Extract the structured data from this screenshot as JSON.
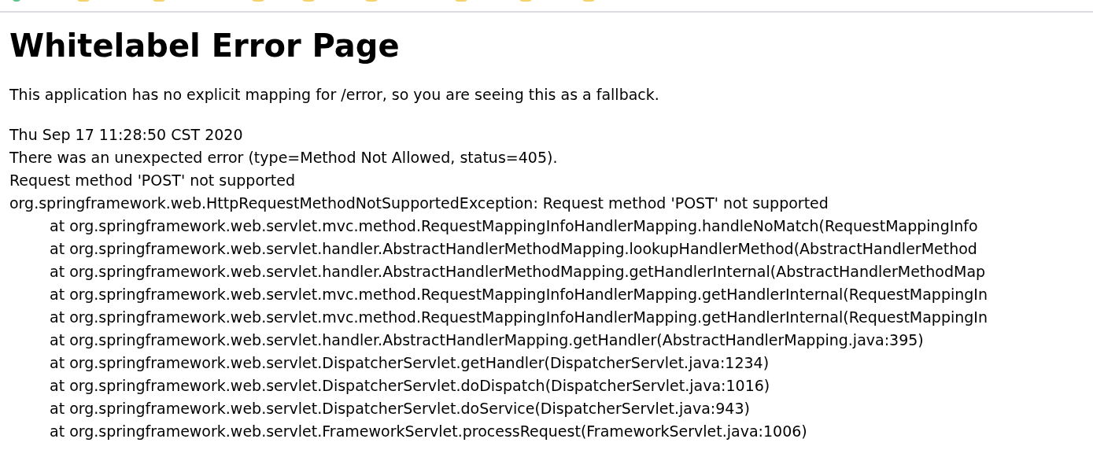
{
  "bookmarks_bar": {
    "items": [
      {
        "kind": "site"
      },
      {
        "kind": "folder"
      },
      {
        "kind": "folder"
      },
      {
        "kind": "folder"
      },
      {
        "kind": "folder"
      },
      {
        "kind": "folder"
      },
      {
        "kind": "folder"
      },
      {
        "kind": "folder"
      },
      {
        "kind": "folder"
      }
    ]
  },
  "heading": "Whitelabel Error Page",
  "message": "This application has no explicit mapping for /error, so you are seeing this as a fallback.",
  "details": [
    "Thu Sep 17 11:28:50 CST 2020",
    "There was an unexpected error (type=Method Not Allowed, status=405).",
    "Request method 'POST' not supported",
    "org.springframework.web.HttpRequestMethodNotSupportedException: Request method 'POST' not supported"
  ],
  "stack_trace": [
    "at org.springframework.web.servlet.mvc.method.RequestMappingInfoHandlerMapping.handleNoMatch(RequestMappingInfo",
    "at org.springframework.web.servlet.handler.AbstractHandlerMethodMapping.lookupHandlerMethod(AbstractHandlerMethod",
    "at org.springframework.web.servlet.handler.AbstractHandlerMethodMapping.getHandlerInternal(AbstractHandlerMethodMap",
    "at org.springframework.web.servlet.mvc.method.RequestMappingInfoHandlerMapping.getHandlerInternal(RequestMappingIn",
    "at org.springframework.web.servlet.mvc.method.RequestMappingInfoHandlerMapping.getHandlerInternal(RequestMappingIn",
    "at org.springframework.web.servlet.handler.AbstractHandlerMapping.getHandler(AbstractHandlerMapping.java:395)",
    "at org.springframework.web.servlet.DispatcherServlet.getHandler(DispatcherServlet.java:1234)",
    "at org.springframework.web.servlet.DispatcherServlet.doDispatch(DispatcherServlet.java:1016)",
    "at org.springframework.web.servlet.DispatcherServlet.doService(DispatcherServlet.java:943)",
    "at org.springframework.web.servlet.FrameworkServlet.processRequest(FrameworkServlet.java:1006)"
  ]
}
